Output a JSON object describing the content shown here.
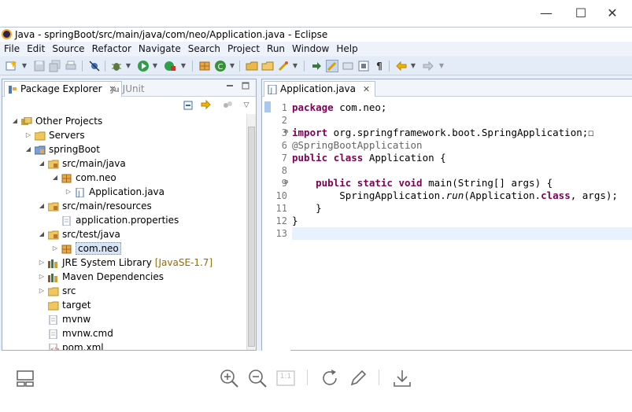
{
  "window": {
    "title": "Java - springBoot/src/main/java/com/neo/Application.java - Eclipse",
    "controls": {
      "minimize": "—",
      "maximize": "☐",
      "close": "✕"
    }
  },
  "menu": [
    "File",
    "Edit",
    "Source",
    "Refactor",
    "Navigate",
    "Search",
    "Project",
    "Run",
    "Window",
    "Help"
  ],
  "package_explorer": {
    "tab_label": "Package Explorer",
    "tab_close": "✕",
    "inactive_tab": "JUnit",
    "inactive_tab_prefix": "Ju",
    "tree": [
      {
        "label": "Other Projects",
        "decoration": "",
        "depth": 0,
        "toggle": "open",
        "icon": "working-set-icon"
      },
      {
        "label": "Servers",
        "decoration": "",
        "depth": 1,
        "toggle": "closed",
        "icon": "folder-icon"
      },
      {
        "label": "springBoot",
        "decoration": "",
        "depth": 1,
        "toggle": "open",
        "icon": "project-icon"
      },
      {
        "label": "src/main/java",
        "decoration": "",
        "depth": 2,
        "toggle": "open",
        "icon": "source-folder-icon"
      },
      {
        "label": "com.neo",
        "decoration": "",
        "depth": 3,
        "toggle": "open",
        "icon": "package-icon"
      },
      {
        "label": "Application.java",
        "decoration": "",
        "depth": 4,
        "toggle": "closed",
        "icon": "java-file-icon"
      },
      {
        "label": "src/main/resources",
        "decoration": "",
        "depth": 2,
        "toggle": "open",
        "icon": "source-folder-icon"
      },
      {
        "label": "application.properties",
        "decoration": "",
        "depth": 3,
        "toggle": "none",
        "icon": "file-icon"
      },
      {
        "label": "src/test/java",
        "decoration": "",
        "depth": 2,
        "toggle": "open",
        "icon": "source-folder-icon"
      },
      {
        "label": "com.neo",
        "decoration": "",
        "depth": 3,
        "toggle": "closed",
        "icon": "package-icon",
        "selected": true
      },
      {
        "label": "JRE System Library",
        "decoration": "[JavaSE-1.7]",
        "depth": 2,
        "toggle": "closed",
        "icon": "library-icon"
      },
      {
        "label": "Maven Dependencies",
        "decoration": "",
        "depth": 2,
        "toggle": "closed",
        "icon": "library-icon"
      },
      {
        "label": "src",
        "decoration": "",
        "depth": 2,
        "toggle": "closed",
        "icon": "folder-icon"
      },
      {
        "label": "target",
        "decoration": "",
        "depth": 2,
        "toggle": "none",
        "icon": "folder-icon"
      },
      {
        "label": "mvnw",
        "decoration": "",
        "depth": 2,
        "toggle": "none",
        "icon": "file-icon"
      },
      {
        "label": "mvnw.cmd",
        "decoration": "",
        "depth": 2,
        "toggle": "none",
        "icon": "file-icon"
      },
      {
        "label": "pom.xml",
        "decoration": "",
        "depth": 2,
        "toggle": "none",
        "icon": "xml-file-icon"
      }
    ]
  },
  "editor": {
    "tab_label": "Application.java",
    "tab_close": "✕",
    "line_numbers": [
      "1",
      "2",
      "3",
      "6",
      "7",
      "8",
      "9",
      "10",
      "11",
      "12",
      "13"
    ],
    "fold_markers": {
      "3": "⊕",
      "9": "⊖"
    },
    "lines": [
      [
        {
          "t": "package",
          "c": "kw"
        },
        {
          "t": " com.neo;",
          "c": ""
        }
      ],
      [],
      [
        {
          "t": "import",
          "c": "kw"
        },
        {
          "t": " org.springframework.boot.SpringApplication;",
          "c": ""
        },
        {
          "t": "☐",
          "c": ""
        }
      ],
      [
        {
          "t": "@SpringBootApplication",
          "c": "ann"
        }
      ],
      [
        {
          "t": "public",
          "c": "kw"
        },
        {
          "t": " ",
          "c": ""
        },
        {
          "t": "class",
          "c": "kw"
        },
        {
          "t": " Application {",
          "c": ""
        }
      ],
      [],
      [
        {
          "t": "    ",
          "c": ""
        },
        {
          "t": "public",
          "c": "kw"
        },
        {
          "t": " ",
          "c": ""
        },
        {
          "t": "static",
          "c": "kw"
        },
        {
          "t": " ",
          "c": ""
        },
        {
          "t": "void",
          "c": "kw"
        },
        {
          "t": " main(String[] args) {",
          "c": ""
        }
      ],
      [
        {
          "t": "        SpringApplication.",
          "c": ""
        },
        {
          "t": "run",
          "c": "it"
        },
        {
          "t": "(Application.",
          "c": ""
        },
        {
          "t": "class",
          "c": "kw"
        },
        {
          "t": ", args);",
          "c": ""
        }
      ],
      [
        {
          "t": "    }",
          "c": ""
        }
      ],
      [
        {
          "t": "}",
          "c": ""
        }
      ],
      []
    ],
    "current_line_index": 10
  },
  "viewer_toolbar": {
    "fit_label": "1:1"
  },
  "colors": {
    "keyword": "#7f0055",
    "annotation": "#646464",
    "current_line": "#e8f2fe",
    "window_bg": "#e9eff8"
  }
}
